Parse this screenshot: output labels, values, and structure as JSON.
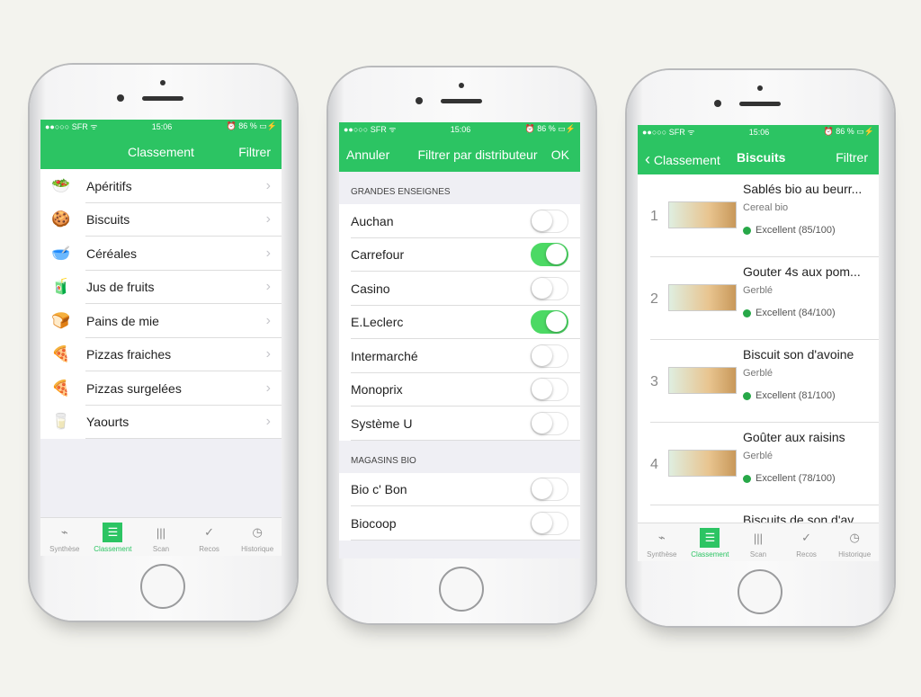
{
  "status": {
    "carrier": "SFR",
    "time": "15:06",
    "battery": "86 %"
  },
  "accent": "#2cc463",
  "tabs": [
    {
      "label": "Synthèse",
      "icon": "carrot-icon"
    },
    {
      "label": "Classement",
      "icon": "list-icon"
    },
    {
      "label": "Scan",
      "icon": "barcode-icon"
    },
    {
      "label": "Recos",
      "icon": "check-circle-icon"
    },
    {
      "label": "Historique",
      "icon": "clock-icon"
    }
  ],
  "phone1": {
    "title": "Classement",
    "right": "Filtrer",
    "items": [
      "Apéritifs",
      "Biscuits",
      "Céréales",
      "Jus de fruits",
      "Pains de mie",
      "Pizzas fraiches",
      "Pizzas surgelées",
      "Yaourts"
    ]
  },
  "phone2": {
    "left": "Annuler",
    "title": "Filtrer par distributeur",
    "right": "OK",
    "sections": [
      {
        "header": "GRANDES ENSEIGNES",
        "items": [
          {
            "label": "Auchan",
            "on": false
          },
          {
            "label": "Carrefour",
            "on": true
          },
          {
            "label": "Casino",
            "on": false
          },
          {
            "label": "E.Leclerc",
            "on": true
          },
          {
            "label": "Intermarché",
            "on": false
          },
          {
            "label": "Monoprix",
            "on": false
          },
          {
            "label": "Système U",
            "on": false
          }
        ]
      },
      {
        "header": "MAGASINS BIO",
        "items": [
          {
            "label": "Bio c' Bon",
            "on": false
          },
          {
            "label": "Biocoop",
            "on": false
          }
        ]
      }
    ]
  },
  "phone3": {
    "back": "Classement",
    "title": "Biscuits",
    "right": "Filtrer",
    "products": [
      {
        "rank": "1",
        "name": "Sablés bio au beurr...",
        "brand": "Cereal bio",
        "score": "Excellent (85/100)"
      },
      {
        "rank": "2",
        "name": "Gouter 4s aux pom...",
        "brand": "Gerblé",
        "score": "Excellent (84/100)"
      },
      {
        "rank": "3",
        "name": "Biscuit son d'avoine",
        "brand": "Gerblé",
        "score": "Excellent (81/100)"
      },
      {
        "rank": "4",
        "name": "Goûter aux raisins",
        "brand": "Gerblé",
        "score": "Excellent (78/100)"
      },
      {
        "rank": "",
        "name": "Biscuits de son d'av...",
        "brand": "",
        "score": ""
      }
    ]
  }
}
